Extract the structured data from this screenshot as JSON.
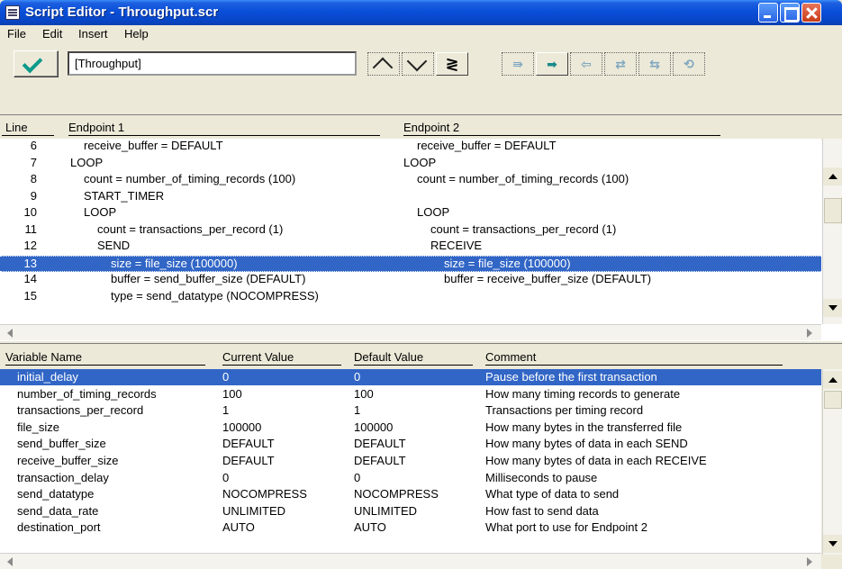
{
  "window": {
    "title": "Script Editor - Throughput.scr"
  },
  "menu": [
    "File",
    "Edit",
    "Insert",
    "Help"
  ],
  "toolbar": {
    "script_name": "[Throughput]"
  },
  "script": {
    "headers": {
      "line": "Line",
      "endpoint1": "Endpoint 1",
      "endpoint2": "Endpoint 2"
    },
    "rows": [
      {
        "num": "6",
        "e1": "receive_buffer = DEFAULT",
        "e1_indent": 1,
        "e2": "receive_buffer = DEFAULT",
        "e2_indent": 1
      },
      {
        "num": "7",
        "e1": "LOOP",
        "e1_indent": 0,
        "e2": "LOOP",
        "e2_indent": 0
      },
      {
        "num": "8",
        "e1": "count = number_of_timing_records (100)",
        "e1_indent": 1,
        "e2": "count = number_of_timing_records (100)",
        "e2_indent": 1
      },
      {
        "num": "9",
        "e1": "START_TIMER",
        "e1_indent": 1,
        "e2": "",
        "e2_indent": 0
      },
      {
        "num": "10",
        "e1": "LOOP",
        "e1_indent": 1,
        "e2": "LOOP",
        "e2_indent": 1
      },
      {
        "num": "11",
        "e1": "count = transactions_per_record (1)",
        "e1_indent": 2,
        "e2": "count = transactions_per_record (1)",
        "e2_indent": 2
      },
      {
        "num": "12",
        "e1": "SEND",
        "e1_indent": 2,
        "e2": "RECEIVE",
        "e2_indent": 2
      },
      {
        "num": "13",
        "e1": "size = file_size (100000)",
        "e1_indent": 3,
        "e2": "size = file_size (100000)",
        "e2_indent": 3,
        "selected": true
      },
      {
        "num": "14",
        "e1": "buffer = send_buffer_size (DEFAULT)",
        "e1_indent": 3,
        "e2": "buffer = receive_buffer_size (DEFAULT)",
        "e2_indent": 3
      },
      {
        "num": "15",
        "e1": "type = send_datatype (NOCOMPRESS)",
        "e1_indent": 3,
        "e2": "",
        "e2_indent": 0
      }
    ]
  },
  "variables": {
    "headers": {
      "name": "Variable Name",
      "current": "Current Value",
      "default": "Default Value",
      "comment": "Comment"
    },
    "rows": [
      {
        "name": "initial_delay",
        "current": "0",
        "default": "0",
        "comment": "Pause before the first transaction",
        "selected": true
      },
      {
        "name": "number_of_timing_records",
        "current": "100",
        "default": "100",
        "comment": "How many timing records to generate"
      },
      {
        "name": "transactions_per_record",
        "current": "1",
        "default": "1",
        "comment": "Transactions per timing record"
      },
      {
        "name": "file_size",
        "current": "100000",
        "default": "100000",
        "comment": "How many bytes in the transferred file"
      },
      {
        "name": "send_buffer_size",
        "current": "DEFAULT",
        "default": "DEFAULT",
        "comment": "How many bytes of data in each SEND"
      },
      {
        "name": "receive_buffer_size",
        "current": "DEFAULT",
        "default": "DEFAULT",
        "comment": "How many bytes of data in each RECEIVE"
      },
      {
        "name": "transaction_delay",
        "current": "0",
        "default": "0",
        "comment": "Milliseconds to pause"
      },
      {
        "name": "send_datatype",
        "current": "NOCOMPRESS",
        "default": "NOCOMPRESS",
        "comment": "What type of data to send"
      },
      {
        "name": "send_data_rate",
        "current": "UNLIMITED",
        "default": "UNLIMITED",
        "comment": "How fast to send data"
      },
      {
        "name": "destination_port",
        "current": "AUTO",
        "default": "AUTO",
        "comment": "What port to use for Endpoint 2"
      }
    ]
  },
  "colors": {
    "selection": "#3166c6",
    "titlebar": "#0a4fd8"
  }
}
